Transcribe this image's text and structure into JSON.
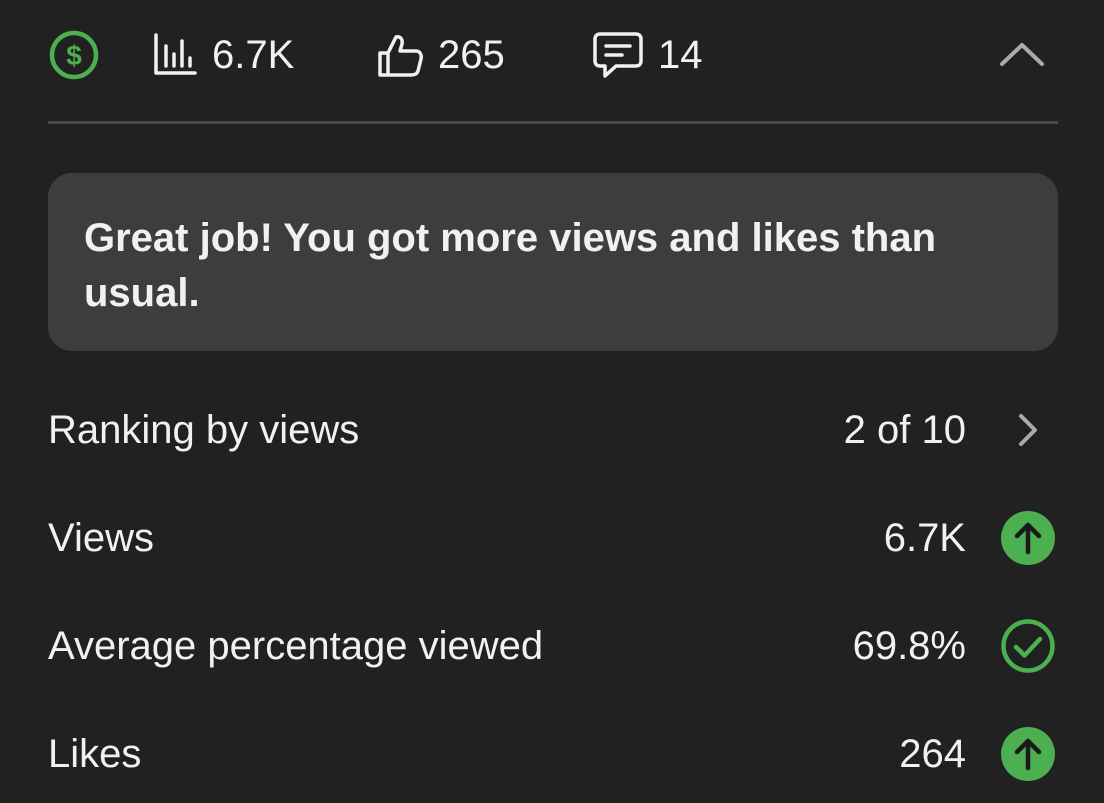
{
  "summary": {
    "monetization_icon": "dollar-circle-icon",
    "views_icon": "bar-chart-icon",
    "views": "6.7K",
    "likes_icon": "thumbs-up-icon",
    "likes": "265",
    "comments_icon": "comment-icon",
    "comments": "14",
    "collapse_icon": "chevron-up-icon"
  },
  "banner": {
    "text": "Great job! You got more views and likes than usual."
  },
  "metrics": [
    {
      "label": "Ranking by views",
      "value": "2 of 10",
      "indicator": "chevron-right-icon"
    },
    {
      "label": "Views",
      "value": "6.7K",
      "indicator": "arrow-up-circle-icon"
    },
    {
      "label": "Average percentage viewed",
      "value": "69.8%",
      "indicator": "check-circle-icon"
    },
    {
      "label": "Likes",
      "value": "264",
      "indicator": "arrow-up-circle-icon"
    }
  ],
  "colors": {
    "background": "#212121",
    "card": "#3d3d3d",
    "accent_green": "#4caf50",
    "text": "#f1f1f1",
    "muted": "#aaaaaa"
  }
}
